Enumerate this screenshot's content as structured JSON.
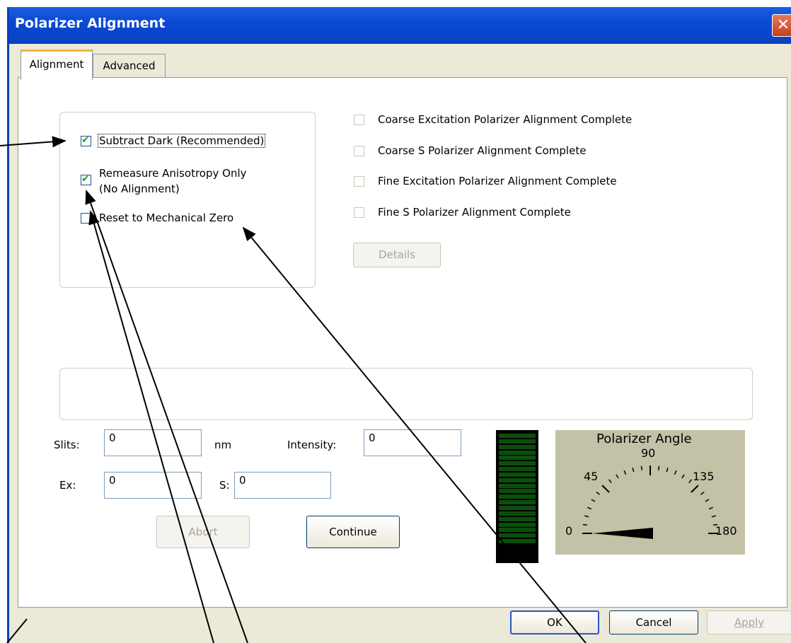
{
  "window": {
    "title": "Polarizer Alignment",
    "close_glyph": "✕"
  },
  "tabs": [
    {
      "label": "Alignment"
    },
    {
      "label": "Advanced"
    }
  ],
  "options": {
    "subtract_dark": {
      "label": "Subtract Dark (Recommended)",
      "checked": true
    },
    "remeasure": {
      "label_line1": "Remeasure Anisotropy Only",
      "label_line2": "(No Alignment)",
      "checked": true
    },
    "reset_zero": {
      "label": "Reset to Mechanical Zero",
      "checked": false
    }
  },
  "status_items": [
    {
      "label": "Coarse Excitation Polarizer Alignment Complete",
      "checked": false
    },
    {
      "label": "Coarse S Polarizer Alignment Complete",
      "checked": false
    },
    {
      "label": "Fine Excitation Polarizer Alignment Complete",
      "checked": false
    },
    {
      "label": "Fine S Polarizer Alignment Complete",
      "checked": false
    }
  ],
  "buttons": {
    "details": "Details",
    "abort": "Abort",
    "continue": "Continue",
    "ok": "OK",
    "cancel": "Cancel",
    "apply": "Apply"
  },
  "fields": {
    "slits": {
      "label": "Slits:",
      "value": "0",
      "unit": "nm"
    },
    "intensity": {
      "label": "Intensity:",
      "value": "0"
    },
    "ex": {
      "label": "Ex:",
      "value": "0"
    },
    "s": {
      "label": "S:",
      "value": "0"
    }
  },
  "intensity_meter": {
    "level": 0,
    "segments": 20
  },
  "polarizer_dial": {
    "title": "Polarizer Angle",
    "labels": {
      "top": "90",
      "upper_left": "45",
      "upper_right": "135",
      "left": "0",
      "right": "180"
    },
    "angle": 0
  },
  "colors": {
    "title_bar": "#0a49d4",
    "meter_segment": "#0b4e0b",
    "dial_background": "#c3c1a6",
    "check_mark": "#21a121"
  }
}
